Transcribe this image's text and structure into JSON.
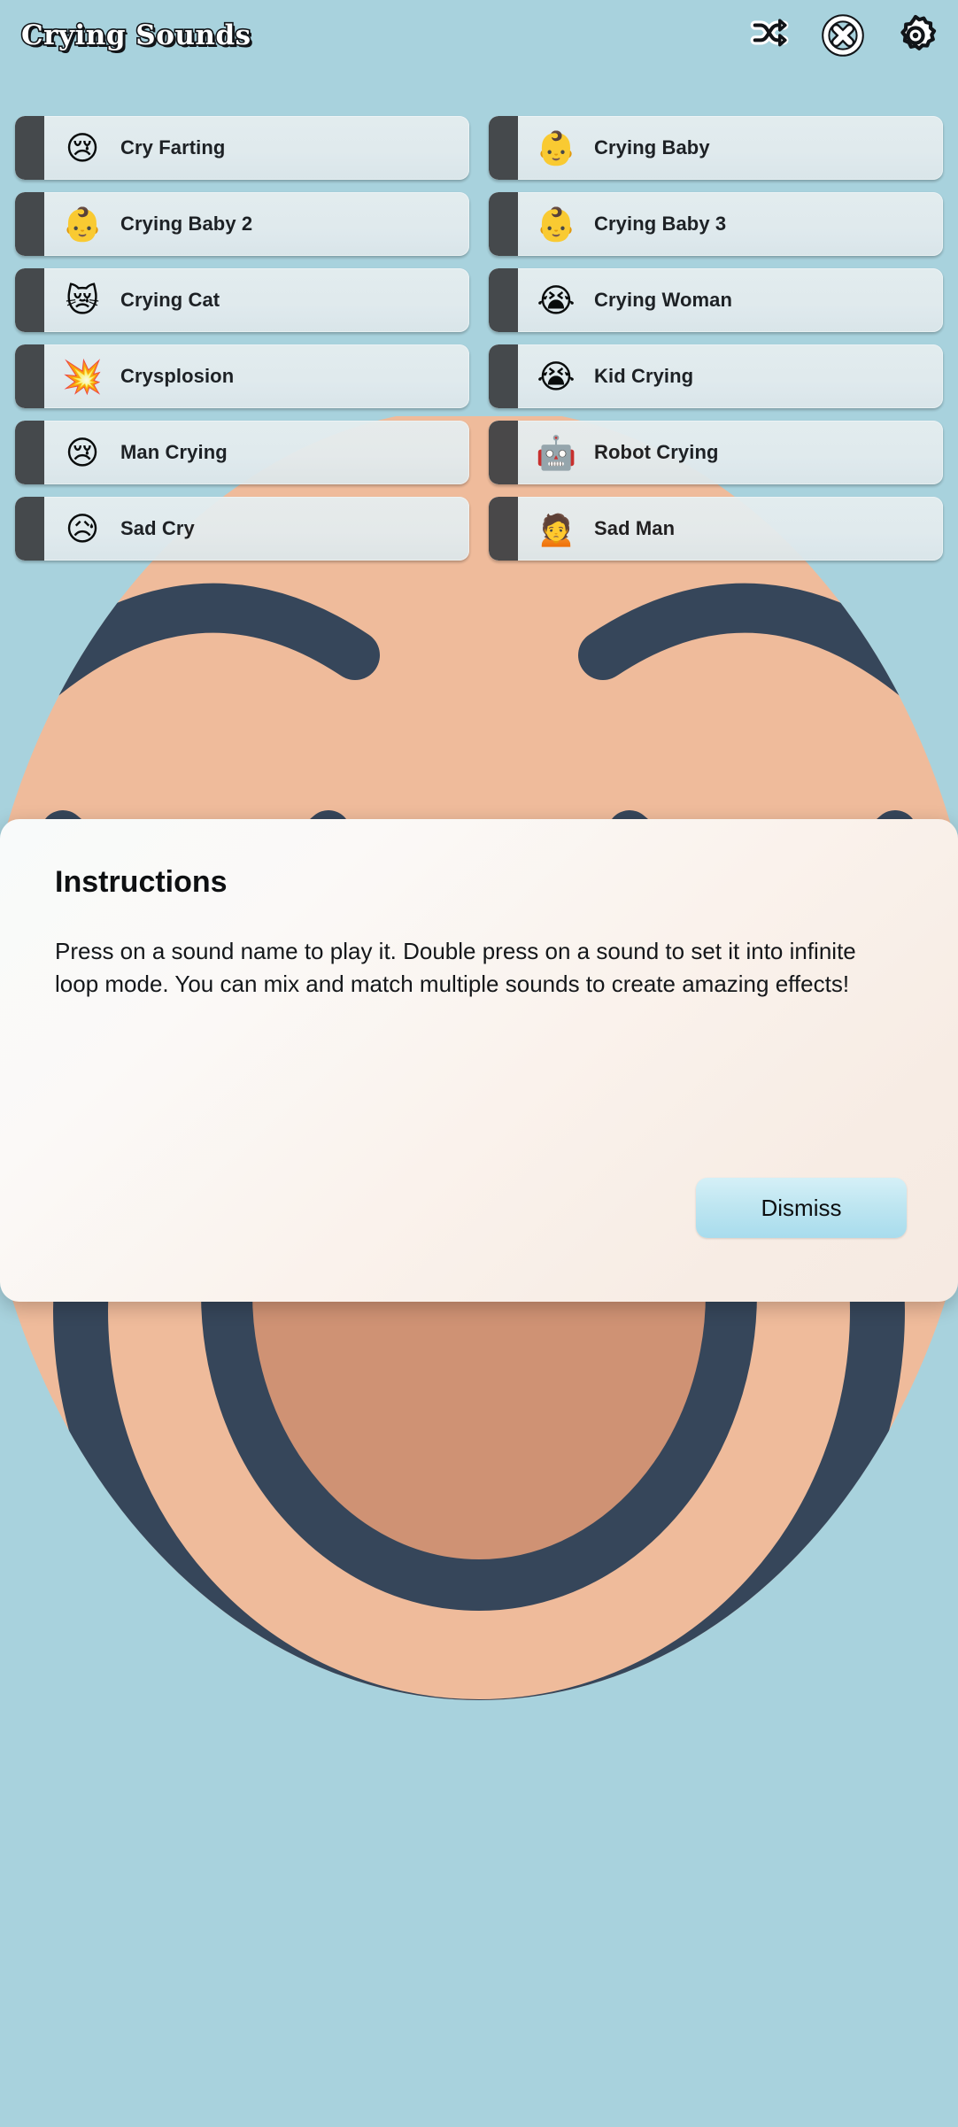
{
  "header": {
    "title": "Crying Sounds",
    "icons": [
      {
        "name": "shuffle-icon",
        "label": "Shuffle"
      },
      {
        "name": "stop-all-icon",
        "label": "Stop All"
      },
      {
        "name": "gear-icon",
        "label": "Settings"
      }
    ]
  },
  "sounds": [
    {
      "label": "Cry Farting",
      "emoji": "😢"
    },
    {
      "label": "Crying Baby",
      "emoji": "👶"
    },
    {
      "label": "Crying Baby 2",
      "emoji": "👶"
    },
    {
      "label": "Crying Baby 3",
      "emoji": "👶"
    },
    {
      "label": "Crying Cat",
      "emoji": "😿"
    },
    {
      "label": "Crying Woman",
      "emoji": "😭"
    },
    {
      "label": "Crysplosion",
      "emoji": "💥"
    },
    {
      "label": "Kid Crying",
      "emoji": "😭"
    },
    {
      "label": "Man Crying",
      "emoji": "😢"
    },
    {
      "label": "Robot Crying",
      "emoji": "🤖"
    },
    {
      "label": "Sad Cry",
      "emoji": "😥"
    },
    {
      "label": "Sad Man",
      "emoji": "🙍"
    }
  ],
  "dialog": {
    "title": "Instructions",
    "body": "Press on a sound name to play it. Double press on a sound to set it into infinite loop mode. You can mix and match multiple sounds to create amazing effects!",
    "dismiss_label": "Dismiss"
  },
  "colors": {
    "background": "#a8d2dd",
    "button_face": "#e4ecef",
    "button_bar": "#3f4144",
    "dismiss": "#bfe6f1",
    "art_outline": "#36465a",
    "art_skin": "#efbb9b",
    "art_mouth": "#cf9274"
  }
}
